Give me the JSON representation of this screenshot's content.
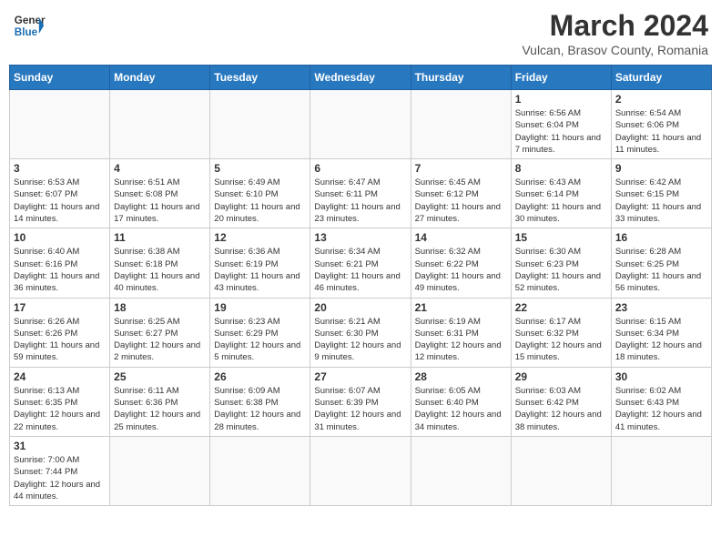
{
  "header": {
    "logo_general": "General",
    "logo_blue": "Blue",
    "month_year": "March 2024",
    "location": "Vulcan, Brasov County, Romania"
  },
  "days_of_week": [
    "Sunday",
    "Monday",
    "Tuesday",
    "Wednesday",
    "Thursday",
    "Friday",
    "Saturday"
  ],
  "weeks": [
    [
      {
        "day": "",
        "info": ""
      },
      {
        "day": "",
        "info": ""
      },
      {
        "day": "",
        "info": ""
      },
      {
        "day": "",
        "info": ""
      },
      {
        "day": "",
        "info": ""
      },
      {
        "day": "1",
        "info": "Sunrise: 6:56 AM\nSunset: 6:04 PM\nDaylight: 11 hours and 7 minutes."
      },
      {
        "day": "2",
        "info": "Sunrise: 6:54 AM\nSunset: 6:06 PM\nDaylight: 11 hours and 11 minutes."
      }
    ],
    [
      {
        "day": "3",
        "info": "Sunrise: 6:53 AM\nSunset: 6:07 PM\nDaylight: 11 hours and 14 minutes."
      },
      {
        "day": "4",
        "info": "Sunrise: 6:51 AM\nSunset: 6:08 PM\nDaylight: 11 hours and 17 minutes."
      },
      {
        "day": "5",
        "info": "Sunrise: 6:49 AM\nSunset: 6:10 PM\nDaylight: 11 hours and 20 minutes."
      },
      {
        "day": "6",
        "info": "Sunrise: 6:47 AM\nSunset: 6:11 PM\nDaylight: 11 hours and 23 minutes."
      },
      {
        "day": "7",
        "info": "Sunrise: 6:45 AM\nSunset: 6:12 PM\nDaylight: 11 hours and 27 minutes."
      },
      {
        "day": "8",
        "info": "Sunrise: 6:43 AM\nSunset: 6:14 PM\nDaylight: 11 hours and 30 minutes."
      },
      {
        "day": "9",
        "info": "Sunrise: 6:42 AM\nSunset: 6:15 PM\nDaylight: 11 hours and 33 minutes."
      }
    ],
    [
      {
        "day": "10",
        "info": "Sunrise: 6:40 AM\nSunset: 6:16 PM\nDaylight: 11 hours and 36 minutes."
      },
      {
        "day": "11",
        "info": "Sunrise: 6:38 AM\nSunset: 6:18 PM\nDaylight: 11 hours and 40 minutes."
      },
      {
        "day": "12",
        "info": "Sunrise: 6:36 AM\nSunset: 6:19 PM\nDaylight: 11 hours and 43 minutes."
      },
      {
        "day": "13",
        "info": "Sunrise: 6:34 AM\nSunset: 6:21 PM\nDaylight: 11 hours and 46 minutes."
      },
      {
        "day": "14",
        "info": "Sunrise: 6:32 AM\nSunset: 6:22 PM\nDaylight: 11 hours and 49 minutes."
      },
      {
        "day": "15",
        "info": "Sunrise: 6:30 AM\nSunset: 6:23 PM\nDaylight: 11 hours and 52 minutes."
      },
      {
        "day": "16",
        "info": "Sunrise: 6:28 AM\nSunset: 6:25 PM\nDaylight: 11 hours and 56 minutes."
      }
    ],
    [
      {
        "day": "17",
        "info": "Sunrise: 6:26 AM\nSunset: 6:26 PM\nDaylight: 11 hours and 59 minutes."
      },
      {
        "day": "18",
        "info": "Sunrise: 6:25 AM\nSunset: 6:27 PM\nDaylight: 12 hours and 2 minutes."
      },
      {
        "day": "19",
        "info": "Sunrise: 6:23 AM\nSunset: 6:29 PM\nDaylight: 12 hours and 5 minutes."
      },
      {
        "day": "20",
        "info": "Sunrise: 6:21 AM\nSunset: 6:30 PM\nDaylight: 12 hours and 9 minutes."
      },
      {
        "day": "21",
        "info": "Sunrise: 6:19 AM\nSunset: 6:31 PM\nDaylight: 12 hours and 12 minutes."
      },
      {
        "day": "22",
        "info": "Sunrise: 6:17 AM\nSunset: 6:32 PM\nDaylight: 12 hours and 15 minutes."
      },
      {
        "day": "23",
        "info": "Sunrise: 6:15 AM\nSunset: 6:34 PM\nDaylight: 12 hours and 18 minutes."
      }
    ],
    [
      {
        "day": "24",
        "info": "Sunrise: 6:13 AM\nSunset: 6:35 PM\nDaylight: 12 hours and 22 minutes."
      },
      {
        "day": "25",
        "info": "Sunrise: 6:11 AM\nSunset: 6:36 PM\nDaylight: 12 hours and 25 minutes."
      },
      {
        "day": "26",
        "info": "Sunrise: 6:09 AM\nSunset: 6:38 PM\nDaylight: 12 hours and 28 minutes."
      },
      {
        "day": "27",
        "info": "Sunrise: 6:07 AM\nSunset: 6:39 PM\nDaylight: 12 hours and 31 minutes."
      },
      {
        "day": "28",
        "info": "Sunrise: 6:05 AM\nSunset: 6:40 PM\nDaylight: 12 hours and 34 minutes."
      },
      {
        "day": "29",
        "info": "Sunrise: 6:03 AM\nSunset: 6:42 PM\nDaylight: 12 hours and 38 minutes."
      },
      {
        "day": "30",
        "info": "Sunrise: 6:02 AM\nSunset: 6:43 PM\nDaylight: 12 hours and 41 minutes."
      }
    ],
    [
      {
        "day": "31",
        "info": "Sunrise: 7:00 AM\nSunset: 7:44 PM\nDaylight: 12 hours and 44 minutes."
      },
      {
        "day": "",
        "info": ""
      },
      {
        "day": "",
        "info": ""
      },
      {
        "day": "",
        "info": ""
      },
      {
        "day": "",
        "info": ""
      },
      {
        "day": "",
        "info": ""
      },
      {
        "day": "",
        "info": ""
      }
    ]
  ]
}
